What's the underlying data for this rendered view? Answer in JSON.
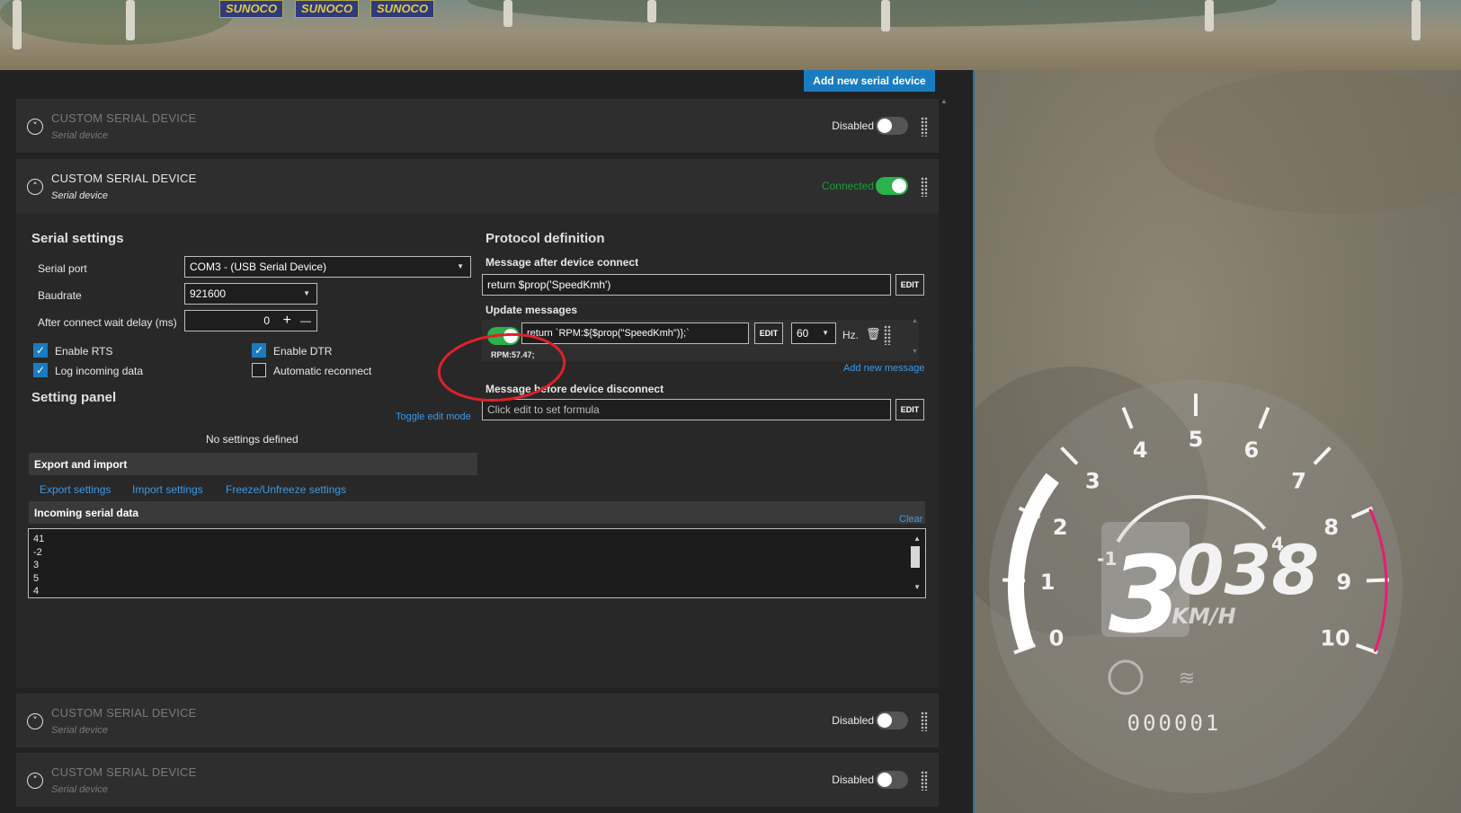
{
  "header": {
    "add_button": "Add new serial device"
  },
  "banners": [
    "SUNOCO",
    "SUNOCO",
    "SUNOCO"
  ],
  "devices": [
    {
      "title": "CUSTOM SERIAL DEVICE",
      "subtitle": "Serial device",
      "status": "Disabled",
      "enabled": false
    },
    {
      "title": "CUSTOM SERIAL DEVICE",
      "subtitle": "Serial device",
      "status": "Connected",
      "enabled": true
    },
    {
      "title": "CUSTOM SERIAL DEVICE",
      "subtitle": "Serial device",
      "status": "Disabled",
      "enabled": false
    },
    {
      "title": "CUSTOM SERIAL DEVICE",
      "subtitle": "Serial device",
      "status": "Disabled",
      "enabled": false
    }
  ],
  "serial_settings": {
    "title": "Serial settings",
    "port_label": "Serial port",
    "port_value": "COM3 -  (USB Serial Device)",
    "baud_label": "Baudrate",
    "baud_value": "921600",
    "delay_label": "After connect wait delay (ms)",
    "delay_value": "0",
    "plus": "+",
    "minus": "—",
    "enable_rts": "Enable RTS",
    "enable_dtr": "Enable DTR",
    "log_incoming": "Log incoming data",
    "auto_reconnect": "Automatic reconnect"
  },
  "setting_panel": {
    "title": "Setting panel",
    "toggle_edit": "Toggle edit mode",
    "empty": "No settings defined"
  },
  "export": {
    "title": "Export and import",
    "export_link": "Export settings",
    "import_link": "Import settings",
    "freeze_link": "Freeze/Unfreeze settings"
  },
  "protocol": {
    "title": "Protocol definition",
    "connect_label": "Message after device connect",
    "connect_value": "return $prop('SpeedKmh')",
    "edit": "EDIT",
    "update_label": "Update messages",
    "update_value": "return `RPM:${$prop(\"SpeedKmh\")};`",
    "rate": "60",
    "hz": "Hz.",
    "preview": "RPM:57.47;",
    "add_message": "Add new message",
    "disconnect_label": "Message before device disconnect",
    "disconnect_placeholder": "Click edit to set formula"
  },
  "incoming": {
    "title": "Incoming serial data",
    "clear": "Clear",
    "lines": [
      "41",
      "-2",
      "3",
      "5",
      "4"
    ]
  },
  "gauge": {
    "speed_big": "3",
    "speed_rest": "038",
    "unit": "KM/H",
    "odometer": "000001",
    "outer_ticks": [
      "0",
      "1",
      "2",
      "3",
      "4",
      "5",
      "6",
      "7",
      "8",
      "9",
      "10"
    ],
    "inner_ticks": [
      "-1",
      "4"
    ]
  },
  "colors": {
    "accent": "#1a7cc0",
    "connected": "#2bb24c",
    "annotation": "#e0202a",
    "redline": "#e61e6e"
  }
}
